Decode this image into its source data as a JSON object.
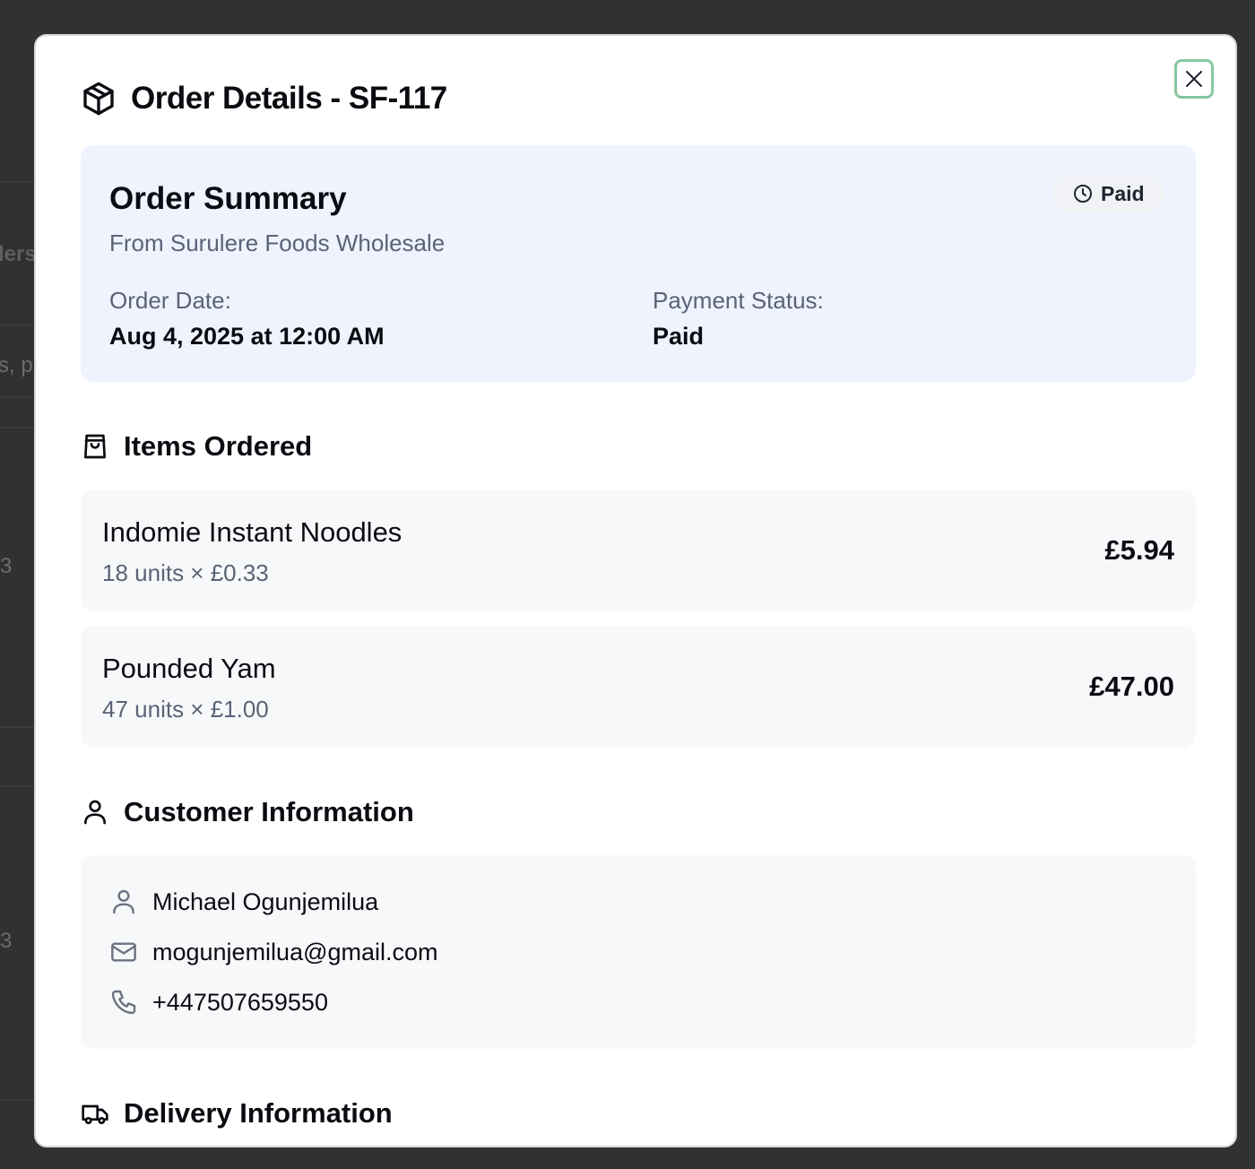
{
  "background": {
    "fragments": [
      "lers",
      "s, p",
      "3",
      "3"
    ]
  },
  "modal": {
    "title": "Order Details - SF-117",
    "close_label": "×"
  },
  "summary": {
    "title": "Order Summary",
    "subtitle": "From Surulere Foods Wholesale",
    "badge": "Paid",
    "order_date_label": "Order Date:",
    "order_date_value": "Aug 4, 2025 at 12:00 AM",
    "payment_status_label": "Payment Status:",
    "payment_status_value": "Paid"
  },
  "items_section": {
    "title": "Items Ordered",
    "items": [
      {
        "name": "Indomie Instant Noodles",
        "qty": "18 units × £0.33",
        "total": "£5.94"
      },
      {
        "name": "Pounded Yam",
        "qty": "47 units × £1.00",
        "total": "£47.00"
      }
    ]
  },
  "customer_section": {
    "title": "Customer Information",
    "name": "Michael Ogunjemilua",
    "email": "mogunjemilua@gmail.com",
    "phone": "+447507659550"
  },
  "delivery_section": {
    "title": "Delivery Information"
  },
  "colors": {
    "overlay": "#313131",
    "summary_bg": "#eef3fd",
    "card_bg": "#f7f8fa",
    "focus_ring": "#86c7a2",
    "muted_text": "#5a6376"
  }
}
